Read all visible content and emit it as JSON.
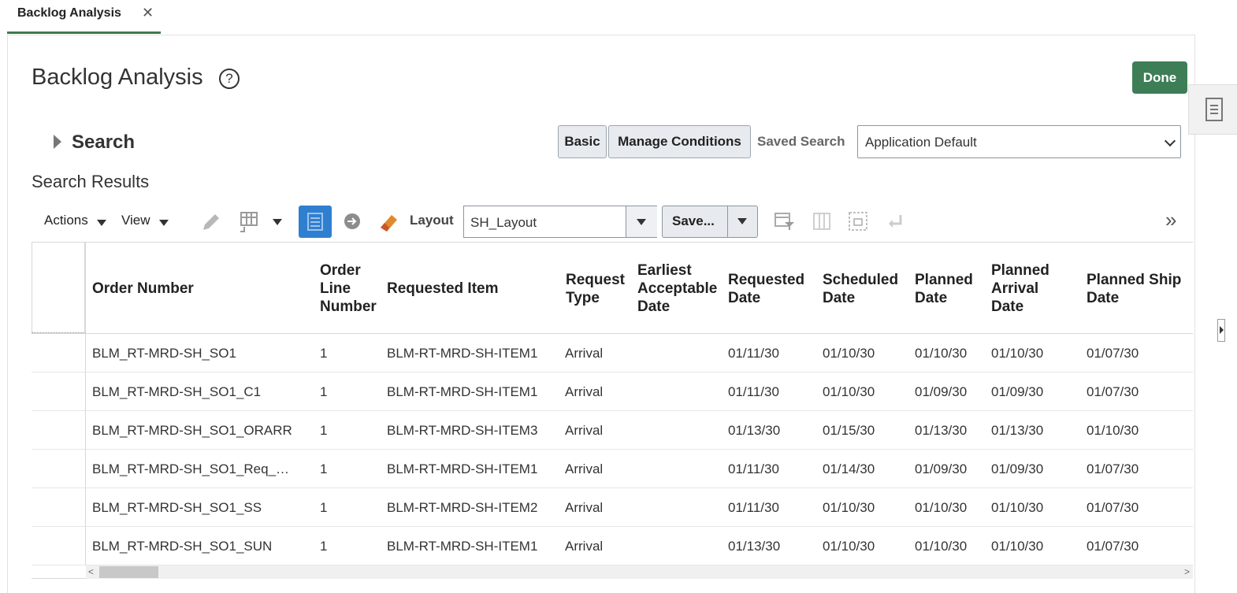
{
  "tab": {
    "label": "Backlog Analysis",
    "close": "✕"
  },
  "page": {
    "title": "Backlog Analysis",
    "help": "?"
  },
  "done_label": "Done",
  "search": {
    "heading": "Search",
    "basic_label": "Basic",
    "manage_label": "Manage Conditions",
    "saved_label": "Saved Search",
    "saved_value": "Application Default"
  },
  "results": {
    "title": "Search Results",
    "toolbar": {
      "actions": "Actions",
      "view": "View",
      "layout_label": "Layout",
      "layout_value": "SH_Layout",
      "save_label": "Save...",
      "overflow": "»"
    },
    "columns": [
      [
        "Order Number"
      ],
      [
        "Order",
        "Line",
        "Number"
      ],
      [
        "Requested Item"
      ],
      [
        "Request",
        "Type"
      ],
      [
        "Earliest",
        "Acceptable",
        "Date"
      ],
      [
        "Requested",
        "Date"
      ],
      [
        "Scheduled",
        "Date"
      ],
      [
        "Planned",
        "Date"
      ],
      [
        "Planned",
        "Arrival",
        "Date"
      ],
      [
        "Planned Ship",
        "Date"
      ]
    ],
    "rows": [
      [
        "BLM_RT-MRD-SH_SO1",
        "1",
        "BLM-RT-MRD-SH-ITEM1",
        "Arrival",
        "",
        "01/11/30",
        "01/10/30",
        "01/10/30",
        "01/10/30",
        "01/07/30"
      ],
      [
        "BLM_RT-MRD-SH_SO1_C1",
        "1",
        "BLM-RT-MRD-SH-ITEM1",
        "Arrival",
        "",
        "01/11/30",
        "01/10/30",
        "01/09/30",
        "01/09/30",
        "01/07/30"
      ],
      [
        "BLM_RT-MRD-SH_SO1_ORARR",
        "1",
        "BLM-RT-MRD-SH-ITEM3",
        "Arrival",
        "",
        "01/13/30",
        "01/15/30",
        "01/13/30",
        "01/13/30",
        "01/10/30"
      ],
      [
        "BLM_RT-MRD-SH_SO1_Req_…",
        "1",
        "BLM-RT-MRD-SH-ITEM1",
        "Arrival",
        "",
        "01/11/30",
        "01/14/30",
        "01/09/30",
        "01/09/30",
        "01/07/30"
      ],
      [
        "BLM_RT-MRD-SH_SO1_SS",
        "1",
        "BLM-RT-MRD-SH-ITEM2",
        "Arrival",
        "",
        "01/11/30",
        "01/10/30",
        "01/10/30",
        "01/10/30",
        "01/07/30"
      ],
      [
        "BLM_RT-MRD-SH_SO1_SUN",
        "1",
        "BLM-RT-MRD-SH-ITEM1",
        "Arrival",
        "",
        "01/13/30",
        "01/10/30",
        "01/10/30",
        "01/10/30",
        "01/07/30"
      ]
    ]
  },
  "colors": {
    "accent": "#3d7e57",
    "tab_underline": "#3f7a4d",
    "detach_active": "#2f7fd0"
  },
  "icons": [
    "close-icon",
    "help-icon",
    "document-icon",
    "expand-triangle-icon",
    "pencil-icon",
    "column-format-icon",
    "detach-icon",
    "go-arrow-icon",
    "eraser-icon",
    "filter-icon",
    "freeze-icon",
    "wrap-icon",
    "enter-icon",
    "overflow-icon"
  ]
}
